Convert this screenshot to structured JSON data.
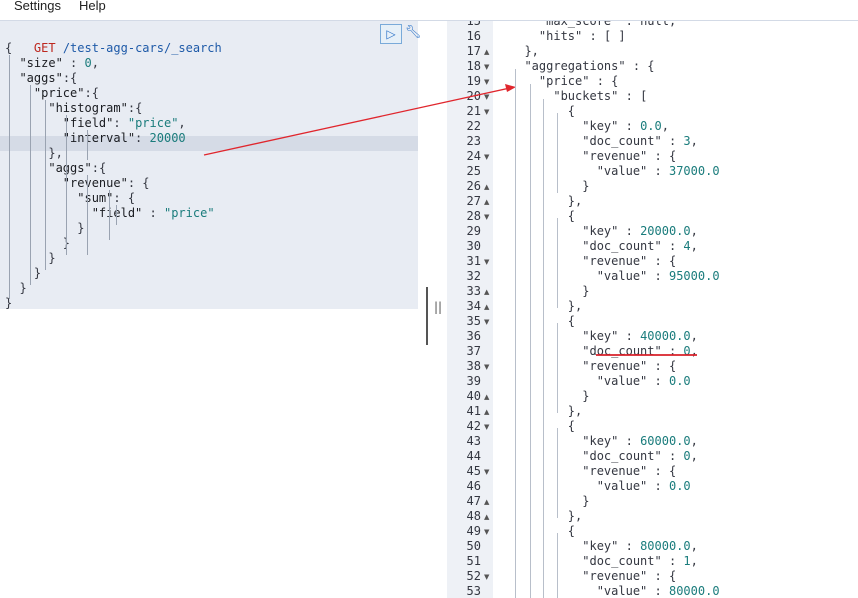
{
  "menu": {
    "settings": "Settings",
    "help": "Help"
  },
  "request": {
    "method": "GET",
    "url": " /test-agg-cars/_search",
    "lines": [
      "{",
      "  \"size\" : 0,",
      "  \"aggs\":{",
      "    \"price\":{",
      "      \"histogram\":{",
      "        \"field\": \"price\",",
      "        \"interval\": 20000",
      "      },",
      "      \"aggs\":{",
      "        \"revenue\": {",
      "          \"sum\": {",
      "            \"field\" : \"price\"",
      "          }",
      "        }",
      "      }",
      "    }",
      "  }",
      "}"
    ],
    "run_icon": "play-icon",
    "settings_icon": "wrench-icon"
  },
  "resizer_glyph": "||",
  "response": {
    "lines": [
      {
        "n": "15",
        "fold": "",
        "text": "    \"max_score\" : null,"
      },
      {
        "n": "16",
        "fold": "",
        "text": "    \"hits\" : [ ]"
      },
      {
        "n": "17",
        "fold": "▲",
        "text": "  },"
      },
      {
        "n": "18",
        "fold": "▼",
        "text": "  \"aggregations\" : {"
      },
      {
        "n": "19",
        "fold": "▼",
        "text": "    \"price\" : {"
      },
      {
        "n": "20",
        "fold": "▼",
        "text": "      \"buckets\" : ["
      },
      {
        "n": "21",
        "fold": "▼",
        "text": "        {"
      },
      {
        "n": "22",
        "fold": "",
        "text": "          \"key\" : 0.0,"
      },
      {
        "n": "23",
        "fold": "",
        "text": "          \"doc_count\" : 3,"
      },
      {
        "n": "24",
        "fold": "▼",
        "text": "          \"revenue\" : {"
      },
      {
        "n": "25",
        "fold": "",
        "text": "            \"value\" : 37000.0"
      },
      {
        "n": "26",
        "fold": "▲",
        "text": "          }"
      },
      {
        "n": "27",
        "fold": "▲",
        "text": "        },"
      },
      {
        "n": "28",
        "fold": "▼",
        "text": "        {"
      },
      {
        "n": "29",
        "fold": "",
        "text": "          \"key\" : 20000.0,"
      },
      {
        "n": "30",
        "fold": "",
        "text": "          \"doc_count\" : 4,"
      },
      {
        "n": "31",
        "fold": "▼",
        "text": "          \"revenue\" : {"
      },
      {
        "n": "32",
        "fold": "",
        "text": "            \"value\" : 95000.0"
      },
      {
        "n": "33",
        "fold": "▲",
        "text": "          }"
      },
      {
        "n": "34",
        "fold": "▲",
        "text": "        },"
      },
      {
        "n": "35",
        "fold": "▼",
        "text": "        {"
      },
      {
        "n": "36",
        "fold": "",
        "text": "          \"key\" : 40000.0,"
      },
      {
        "n": "37",
        "fold": "",
        "text": "          \"doc_count\" : 0,"
      },
      {
        "n": "38",
        "fold": "▼",
        "text": "          \"revenue\" : {"
      },
      {
        "n": "39",
        "fold": "",
        "text": "            \"value\" : 0.0"
      },
      {
        "n": "40",
        "fold": "▲",
        "text": "          }"
      },
      {
        "n": "41",
        "fold": "▲",
        "text": "        },"
      },
      {
        "n": "42",
        "fold": "▼",
        "text": "        {"
      },
      {
        "n": "43",
        "fold": "",
        "text": "          \"key\" : 60000.0,"
      },
      {
        "n": "44",
        "fold": "",
        "text": "          \"doc_count\" : 0,"
      },
      {
        "n": "45",
        "fold": "▼",
        "text": "          \"revenue\" : {"
      },
      {
        "n": "46",
        "fold": "",
        "text": "            \"value\" : 0.0"
      },
      {
        "n": "47",
        "fold": "▲",
        "text": "          }"
      },
      {
        "n": "48",
        "fold": "▲",
        "text": "        },"
      },
      {
        "n": "49",
        "fold": "▼",
        "text": "        {"
      },
      {
        "n": "50",
        "fold": "",
        "text": "          \"key\" : 80000.0,"
      },
      {
        "n": "51",
        "fold": "",
        "text": "          \"doc_count\" : 1,"
      },
      {
        "n": "52",
        "fold": "▼",
        "text": "          \"revenue\" : {"
      },
      {
        "n": "53",
        "fold": "",
        "text": "            \"value\" : 80000.0"
      }
    ]
  },
  "colors": {
    "annotation": "#e0262d",
    "string": "#1a7c7c",
    "method": "#bd271e"
  }
}
